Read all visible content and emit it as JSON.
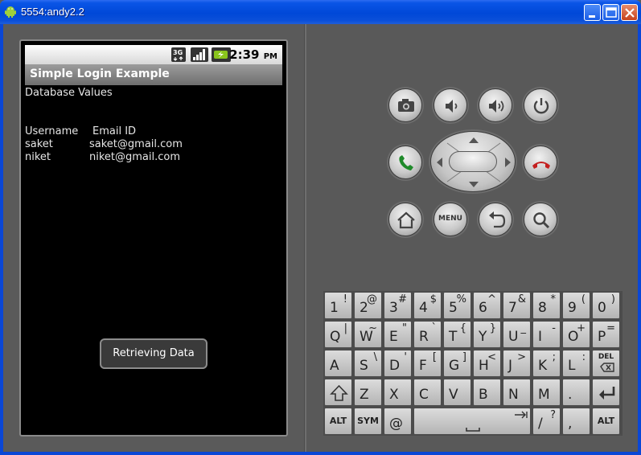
{
  "window": {
    "title": "5554:andy2.2"
  },
  "phone": {
    "status": {
      "network": "3G",
      "time": "2:39",
      "ampm": "PM"
    },
    "app_title": "Simple Login Example",
    "heading": "Database Values",
    "table": {
      "headers": [
        "Username",
        "Email ID"
      ],
      "rows": [
        [
          "saket",
          "saket@gmail.com"
        ],
        [
          "niket",
          "niket@gmail.com"
        ]
      ]
    },
    "toast": "Retrieving Data"
  },
  "controls": {
    "menu_label": "MENU"
  },
  "keyboard": {
    "row1": [
      {
        "main": "1",
        "alt": "!"
      },
      {
        "main": "2",
        "alt": "@"
      },
      {
        "main": "3",
        "alt": "#"
      },
      {
        "main": "4",
        "alt": "$"
      },
      {
        "main": "5",
        "alt": "%"
      },
      {
        "main": "6",
        "alt": "^"
      },
      {
        "main": "7",
        "alt": "&"
      },
      {
        "main": "8",
        "alt": "*"
      },
      {
        "main": "9",
        "alt": "("
      },
      {
        "main": "0",
        "alt": ")"
      }
    ],
    "row2": [
      {
        "main": "Q",
        "alt": "|"
      },
      {
        "main": "W",
        "alt": "~"
      },
      {
        "main": "E",
        "alt": "\""
      },
      {
        "main": "R",
        "alt": "`"
      },
      {
        "main": "T",
        "alt": "{"
      },
      {
        "main": "Y",
        "alt": "}"
      },
      {
        "main": "U",
        "alt": "_"
      },
      {
        "main": "I",
        "alt": "-"
      },
      {
        "main": "O",
        "alt": "+"
      },
      {
        "main": "P",
        "alt": "="
      }
    ],
    "row3": [
      {
        "main": "A",
        "alt": ""
      },
      {
        "main": "S",
        "alt": "\\"
      },
      {
        "main": "D",
        "alt": "'"
      },
      {
        "main": "F",
        "alt": "["
      },
      {
        "main": "G",
        "alt": "]"
      },
      {
        "main": "H",
        "alt": "<"
      },
      {
        "main": "J",
        "alt": ">"
      },
      {
        "main": "K",
        "alt": ";"
      },
      {
        "main": "L",
        "alt": ":"
      }
    ],
    "del_label": "DEL",
    "row4": [
      {
        "main": "Z",
        "alt": ""
      },
      {
        "main": "X",
        "alt": ""
      },
      {
        "main": "C",
        "alt": ""
      },
      {
        "main": "V",
        "alt": ""
      },
      {
        "main": "B",
        "alt": ""
      },
      {
        "main": "N",
        "alt": ""
      },
      {
        "main": "M",
        "alt": ""
      },
      {
        "main": ".",
        "alt": ""
      }
    ],
    "alt_label": "ALT",
    "sym_label": "SYM",
    "at_label": "@",
    "slash_main": "/",
    "slash_alt": "?",
    "comma_main": ",",
    "space_label": "␣"
  }
}
